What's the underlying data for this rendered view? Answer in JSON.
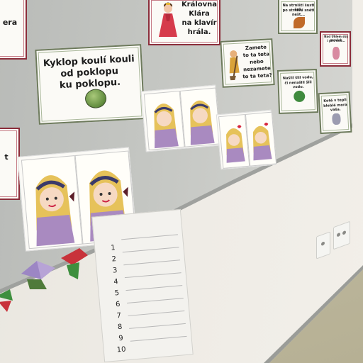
{
  "scene": {
    "colors": {
      "board": "#c4c6c2",
      "wall": "#efece6",
      "floor": "#c1bb9f",
      "paper": "#fbfaf6"
    },
    "signs": {
      "cut_off_top_left": "era",
      "kyklop": [
        "Kyklop koulí kouli",
        "od poklopu",
        "ku poklopu."
      ],
      "kralovna": [
        "Královna",
        "Klára",
        "na klavír",
        "hrála."
      ],
      "zamete": [
        "Zamete",
        "to ta teta",
        "nebo",
        "nezamete",
        "to ta teta?"
      ],
      "cut_off_left": "t",
      "right_small_1": [
        "Na strništi šusti šeš,",
        "po strništi sněti nešt..."
      ],
      "right_small_2": [
        "Nad Úhlem ský ne ořeh",
        "i přiš nev..."
      ],
      "right_small_3": [
        "Našlil šlil vodu,",
        "či nenašlil šlil vodu."
      ],
      "right_small_4": [
        "Kotě v tepli",
        "bleblé mora vaša."
      ]
    },
    "handout": {
      "numbers": [
        "1",
        "2",
        "3",
        "4",
        "5",
        "6",
        "7",
        "8",
        "9",
        "10"
      ]
    },
    "icons": [
      "princess-figure",
      "green-ball",
      "girl-drawing",
      "paper-crane",
      "wall-socket"
    ]
  }
}
